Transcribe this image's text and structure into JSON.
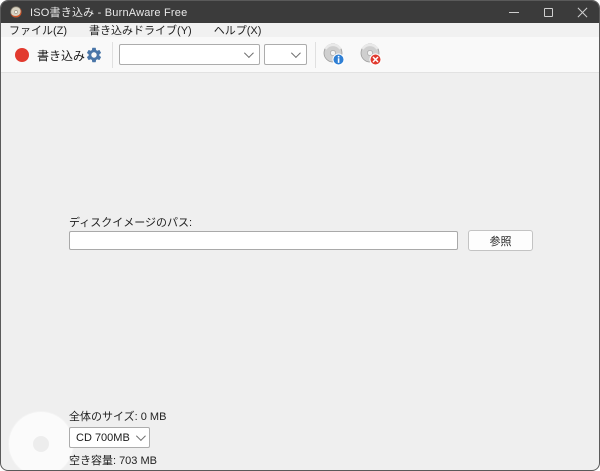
{
  "window": {
    "title": "ISO書き込み - BurnAware Free",
    "icons": {
      "app": "burnaware-disc-flame",
      "minimize": "minimize-line",
      "maximize": "maximize-square",
      "close": "close-x"
    }
  },
  "menu": {
    "items": [
      {
        "label": "ファイル(Z)"
      },
      {
        "label": "書き込みドライブ(Y)"
      },
      {
        "label": "ヘルプ(X)"
      }
    ]
  },
  "toolbar": {
    "burn_label": "書き込み",
    "icons": {
      "burn": "red-circle",
      "settings": "blue-gear",
      "disc_info": "disc-with-blue-info-badge",
      "disc_erase": "disc-with-red-erase-badge"
    },
    "drive_select_value": "",
    "speed_select_value": ""
  },
  "main": {
    "path_label": "ディスクイメージのパス:",
    "path_value": "",
    "browse_label": "参照"
  },
  "footer": {
    "total_size_label": "全体のサイズ:",
    "total_size_value": "0 MB",
    "media_select_value": "CD 700MB",
    "free_space_label": "空き容量:",
    "free_space_value": "703 MB"
  },
  "colors": {
    "titlebar_bg": "#3b3b3b",
    "accent_red": "#e23a2e",
    "gear_blue": "#4a76a8",
    "badge_blue": "#2f7fd4",
    "badge_red": "#e03a2f",
    "content_bg": "#efefef"
  }
}
